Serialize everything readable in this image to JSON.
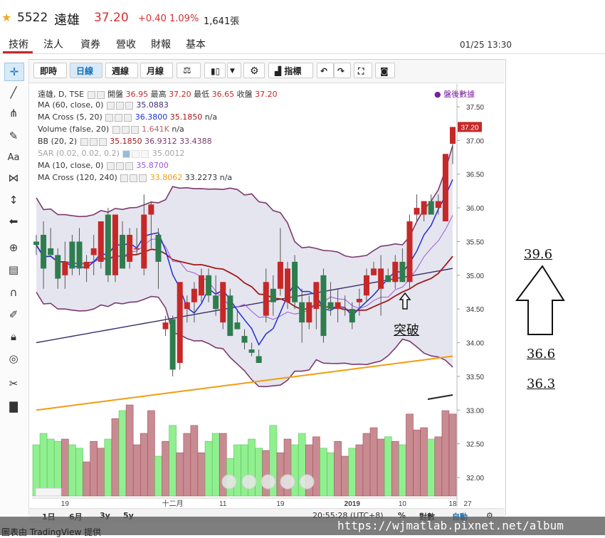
{
  "header": {
    "code": "5522",
    "name": "遠雄",
    "price": "37.20",
    "change": "+0.40",
    "change_pct": "1.09%",
    "volume": "1,641張"
  },
  "tabs": [
    "技術",
    "法人",
    "資券",
    "營收",
    "財報",
    "基本"
  ],
  "datetime": "01/25 13:30",
  "toolbar": {
    "intraday": "即時",
    "daily": "日線",
    "weekly": "週線",
    "monthly": "月線",
    "indicators": "指標"
  },
  "legend": {
    "title": "遠雄, D, TSE",
    "open_label": "開盤",
    "open": "36.95",
    "high_label": "最高",
    "high": "37.20",
    "low_label": "最低",
    "low": "36.65",
    "close_label": "收盤",
    "close": "37.20",
    "after_hours": "盤後數據",
    "rows": [
      {
        "name": "MA (60, close, 0)",
        "v1": "35.0883",
        "v2": "",
        "v3": ""
      },
      {
        "name": "MA Cross (5, 20)",
        "v1": "36.3800",
        "v2": "35.1850",
        "v3": "n/a"
      },
      {
        "name": "Volume (false, 20)",
        "v1": "1.641K",
        "v2": "n/a",
        "v3": ""
      },
      {
        "name": "BB (20, 2)",
        "v1": "35.1850",
        "v2": "36.9312",
        "v3": "33.4388"
      },
      {
        "name": "SAR (0.02, 0.02, 0.2)",
        "v1": "35.0012",
        "v2": "",
        "v3": ""
      },
      {
        "name": "MA (10, close, 0)",
        "v1": "35.8700",
        "v2": "",
        "v3": ""
      },
      {
        "name": "MA Cross (120, 240)",
        "v1": "33.8062",
        "v2": "33.2273",
        "v3": "n/a"
      }
    ]
  },
  "price_axis": [
    "37.50",
    "37.00",
    "36.50",
    "36.00",
    "35.50",
    "35.00",
    "34.50",
    "34.00",
    "33.50",
    "33.00",
    "32.50",
    "32.00"
  ],
  "last_price_tag": "37.20",
  "x_axis": [
    "19",
    "十二月",
    "11",
    "19",
    "2019",
    "10",
    "18",
    "27"
  ],
  "bottom": {
    "range_1d": "1日",
    "range_6m": "6月",
    "range_3y": "3y",
    "range_5y": "5y",
    "clock": "20:55:28 (UTC+8)",
    "pct": "%",
    "log": "對數",
    "auto": "自動"
  },
  "annotations": {
    "breakout": "突破",
    "target": "39.6",
    "level1": "36.6",
    "level2": "36.3"
  },
  "watermark": {
    "left": "圖表由 TradingView 提供",
    "url": "https://wjmatlab.pixnet.net/album"
  },
  "colors": {
    "up": "#c62828",
    "down": "#2e7d4f",
    "ma60": "#3b2f6b",
    "ma_cross_fast": "#1f2fd6",
    "ma_cross_slow": "#a01a1a",
    "bb": "#7b3b6e",
    "ma10": "#9b59d6",
    "ma120": "#f39c12"
  },
  "chart_data": {
    "type": "candlestick",
    "ylim": [
      31.6,
      37.7
    ],
    "candles": [
      {
        "o": 35.5,
        "h": 35.6,
        "l": 35.3,
        "c": 35.45
      },
      {
        "o": 35.6,
        "h": 35.8,
        "l": 34.8,
        "c": 35.1
      },
      {
        "o": 35.4,
        "h": 35.7,
        "l": 35.3,
        "c": 35.3
      },
      {
        "o": 35.3,
        "h": 35.4,
        "l": 34.8,
        "c": 34.95
      },
      {
        "o": 35.0,
        "h": 35.5,
        "l": 34.8,
        "c": 35.2
      },
      {
        "o": 35.5,
        "h": 35.6,
        "l": 35.0,
        "c": 35.1
      },
      {
        "o": 35.5,
        "h": 35.7,
        "l": 35.0,
        "c": 35.1
      },
      {
        "o": 35.1,
        "h": 35.3,
        "l": 34.9,
        "c": 35.2
      },
      {
        "o": 35.3,
        "h": 35.6,
        "l": 35.0,
        "c": 35.4
      },
      {
        "o": 35.2,
        "h": 35.8,
        "l": 35.1,
        "c": 35.8
      },
      {
        "o": 35.9,
        "h": 36.0,
        "l": 34.9,
        "c": 35.0
      },
      {
        "o": 35.0,
        "h": 35.9,
        "l": 34.9,
        "c": 35.9
      },
      {
        "o": 35.6,
        "h": 35.8,
        "l": 35.1,
        "c": 35.1
      },
      {
        "o": 35.2,
        "h": 35.7,
        "l": 35.1,
        "c": 35.6
      },
      {
        "o": 35.4,
        "h": 35.7,
        "l": 35.3,
        "c": 35.4
      },
      {
        "o": 35.1,
        "h": 36.2,
        "l": 35.0,
        "c": 35.9
      },
      {
        "o": 35.9,
        "h": 36.1,
        "l": 35.4,
        "c": 36.05
      },
      {
        "o": 35.6,
        "h": 35.7,
        "l": 34.8,
        "c": 35.2
      },
      {
        "o": 34.2,
        "h": 34.4,
        "l": 34.1,
        "c": 34.3
      },
      {
        "o": 34.35,
        "h": 34.4,
        "l": 33.5,
        "c": 33.6
      },
      {
        "o": 33.7,
        "h": 34.9,
        "l": 33.6,
        "c": 34.9
      },
      {
        "o": 34.5,
        "h": 34.7,
        "l": 34.3,
        "c": 34.6
      },
      {
        "o": 34.6,
        "h": 34.9,
        "l": 34.3,
        "c": 34.8
      },
      {
        "o": 34.7,
        "h": 35.1,
        "l": 34.6,
        "c": 35.0
      },
      {
        "o": 35.0,
        "h": 35.1,
        "l": 34.6,
        "c": 34.7
      },
      {
        "o": 34.7,
        "h": 35.0,
        "l": 34.4,
        "c": 34.5
      },
      {
        "o": 34.3,
        "h": 34.9,
        "l": 34.2,
        "c": 34.9
      },
      {
        "o": 34.7,
        "h": 34.8,
        "l": 34.1,
        "c": 34.1
      },
      {
        "o": 34.3,
        "h": 34.5,
        "l": 34.2,
        "c": 34.2
      },
      {
        "o": 34.1,
        "h": 34.2,
        "l": 33.9,
        "c": 34.0
      },
      {
        "o": 33.9,
        "h": 34.0,
        "l": 33.8,
        "c": 33.85
      },
      {
        "o": 33.8,
        "h": 33.9,
        "l": 33.7,
        "c": 33.7
      },
      {
        "o": 34.4,
        "h": 35.1,
        "l": 34.3,
        "c": 34.9
      },
      {
        "o": 34.8,
        "h": 35.0,
        "l": 34.4,
        "c": 34.6
      },
      {
        "o": 34.8,
        "h": 35.7,
        "l": 34.7,
        "c": 35.2
      },
      {
        "o": 34.6,
        "h": 35.2,
        "l": 34.5,
        "c": 35.1
      },
      {
        "o": 35.2,
        "h": 35.3,
        "l": 34.5,
        "c": 34.6
      },
      {
        "o": 34.6,
        "h": 34.8,
        "l": 34.0,
        "c": 34.3
      },
      {
        "o": 34.3,
        "h": 34.7,
        "l": 34.2,
        "c": 34.6
      },
      {
        "o": 34.5,
        "h": 34.9,
        "l": 34.2,
        "c": 34.9
      },
      {
        "o": 35.0,
        "h": 35.1,
        "l": 34.0,
        "c": 34.1
      },
      {
        "o": 34.6,
        "h": 34.9,
        "l": 34.4,
        "c": 34.5
      },
      {
        "o": 34.5,
        "h": 34.8,
        "l": 34.3,
        "c": 34.6
      },
      {
        "o": 34.5,
        "h": 34.7,
        "l": 34.4,
        "c": 34.5
      },
      {
        "o": 34.5,
        "h": 34.6,
        "l": 34.2,
        "c": 34.3
      },
      {
        "o": 34.6,
        "h": 34.8,
        "l": 34.4,
        "c": 34.65
      },
      {
        "o": 34.7,
        "h": 35.1,
        "l": 34.6,
        "c": 35.0
      },
      {
        "o": 35.0,
        "h": 35.2,
        "l": 35.0,
        "c": 35.1
      },
      {
        "o": 34.8,
        "h": 35.3,
        "l": 34.4,
        "c": 35.1
      },
      {
        "o": 35.0,
        "h": 35.1,
        "l": 34.9,
        "c": 34.9
      },
      {
        "o": 34.9,
        "h": 35.3,
        "l": 34.8,
        "c": 35.2
      },
      {
        "o": 35.2,
        "h": 35.4,
        "l": 34.9,
        "c": 34.9
      },
      {
        "o": 34.9,
        "h": 35.9,
        "l": 34.8,
        "c": 35.8
      },
      {
        "o": 35.9,
        "h": 36.2,
        "l": 35.8,
        "c": 36.0
      },
      {
        "o": 35.9,
        "h": 36.1,
        "l": 35.8,
        "c": 36.1
      },
      {
        "o": 36.1,
        "h": 36.2,
        "l": 35.9,
        "c": 35.9
      },
      {
        "o": 36.0,
        "h": 36.2,
        "l": 35.9,
        "c": 36.1
      },
      {
        "o": 35.8,
        "h": 36.8,
        "l": 35.8,
        "c": 36.8
      },
      {
        "o": 36.95,
        "h": 37.2,
        "l": 36.65,
        "c": 37.2
      }
    ],
    "volume": [
      0.45,
      0.55,
      0.5,
      0.48,
      0.5,
      0.45,
      0.42,
      0.3,
      0.48,
      0.42,
      0.5,
      0.68,
      0.75,
      0.8,
      0.45,
      0.55,
      0.75,
      0.35,
      0.48,
      0.62,
      0.38,
      0.55,
      0.62,
      0.38,
      0.48,
      0.55,
      0.55,
      0.33,
      0.45,
      0.45,
      0.5,
      0.42,
      0.4,
      0.62,
      0.38,
      0.5,
      0.45,
      0.55,
      0.45,
      0.52,
      0.42,
      0.38,
      0.48,
      0.35,
      0.42,
      0.45,
      0.55,
      0.6,
      0.5,
      0.52,
      0.48,
      0.45,
      0.72,
      0.58,
      0.6,
      0.5,
      0.52,
      0.75,
      0.72
    ],
    "volume_max_k": 1.7,
    "volume_text": "1.641K"
  }
}
